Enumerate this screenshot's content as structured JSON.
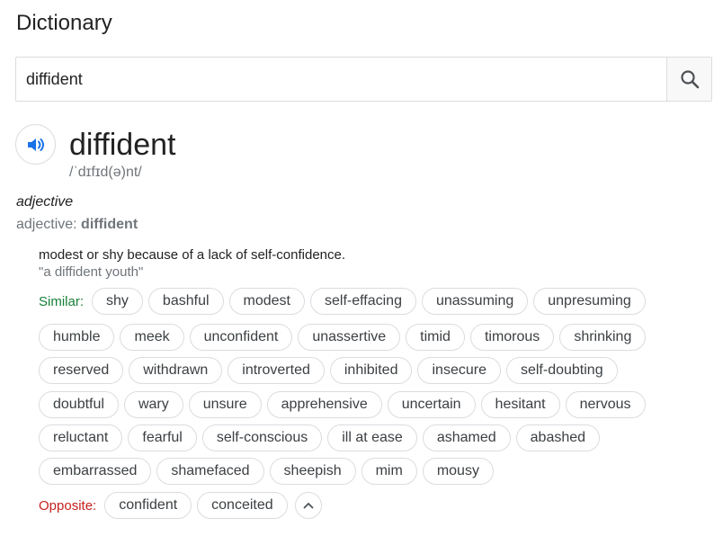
{
  "panel": {
    "title": "Dictionary"
  },
  "search": {
    "value": "diffident"
  },
  "entry": {
    "word": "diffident",
    "phonetic": "/ˈdɪfɪd(ə)nt/",
    "pos_heading": "adjective",
    "pos_prefix": "adjective: ",
    "pos_word": "diffident",
    "definition": "modest or shy because of a lack of self-confidence.",
    "example": "\"a diffident youth\""
  },
  "similar": {
    "label": "Similar:",
    "rows": [
      [
        "shy",
        "bashful",
        "modest",
        "self-effacing",
        "unassuming",
        "unpresuming"
      ],
      [
        "humble",
        "meek",
        "unconfident",
        "unassertive",
        "timid",
        "timorous",
        "shrinking"
      ],
      [
        "reserved",
        "withdrawn",
        "introverted",
        "inhibited",
        "insecure",
        "self-doubting"
      ],
      [
        "doubtful",
        "wary",
        "unsure",
        "apprehensive",
        "uncertain",
        "hesitant",
        "nervous"
      ],
      [
        "reluctant",
        "fearful",
        "self-conscious",
        "ill at ease",
        "ashamed",
        "abashed"
      ],
      [
        "embarrassed",
        "shamefaced",
        "sheepish",
        "mim",
        "mousy"
      ]
    ]
  },
  "opposite": {
    "label": "Opposite:",
    "items": [
      "confident",
      "conceited"
    ]
  },
  "icons": {
    "search": "search-icon",
    "speaker": "speaker-icon",
    "collapse": "chevron-up-icon"
  },
  "colors": {
    "similar_label": "#188038",
    "opposite_label": "#c5221f",
    "speaker_blue": "#1a73e8"
  }
}
